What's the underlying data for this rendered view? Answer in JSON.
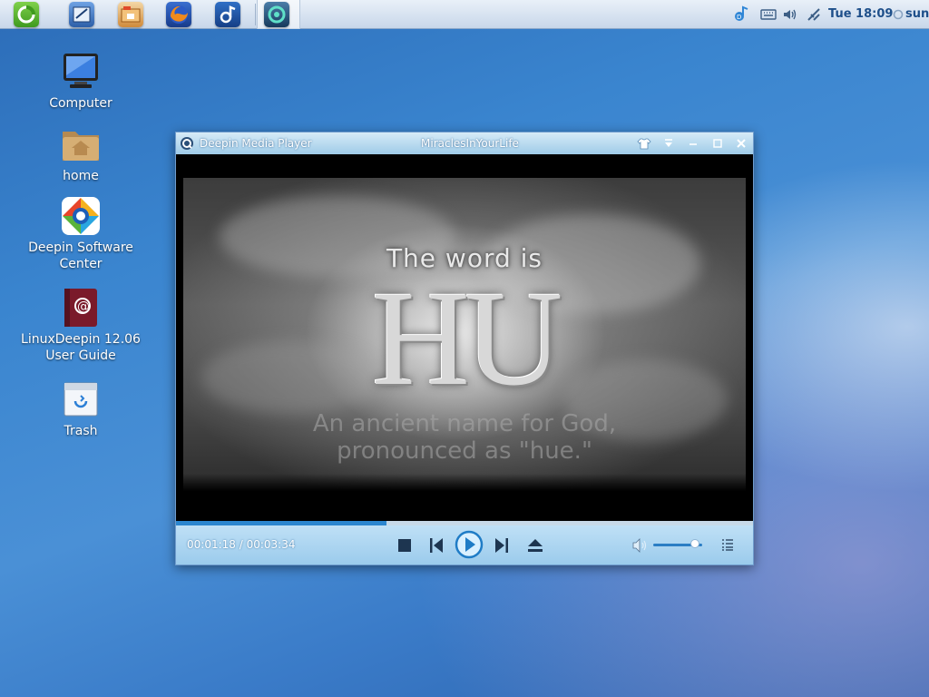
{
  "top_panel": {
    "clock": "Tue 18:09",
    "user": "sun",
    "launchers": [
      {
        "name": "deepin-launcher-icon"
      },
      {
        "name": "text-editor-icon"
      },
      {
        "name": "file-manager-icon"
      },
      {
        "name": "firefox-icon"
      },
      {
        "name": "deepin-music-icon"
      },
      {
        "name": "deepin-media-player-icon"
      }
    ]
  },
  "desktop": {
    "icons": [
      {
        "label": "Computer"
      },
      {
        "label": "home"
      },
      {
        "label": "Deepin Software Center"
      },
      {
        "label": "LinuxDeepin 12.06 User Guide"
      },
      {
        "label": "Trash"
      }
    ]
  },
  "player": {
    "app_title": "Deepin Media Player",
    "file_title": "MiraclesInYourLife",
    "video_text": {
      "line1": "The word is",
      "line2": "HU",
      "line3": "An ancient name for God,",
      "line4": "pronounced as \"hue.\""
    },
    "time_display": "00:01:18 / 00:03:34",
    "progress_fraction": 0.364,
    "volume_fraction": 0.85,
    "accent_color": "#2b86cf"
  }
}
